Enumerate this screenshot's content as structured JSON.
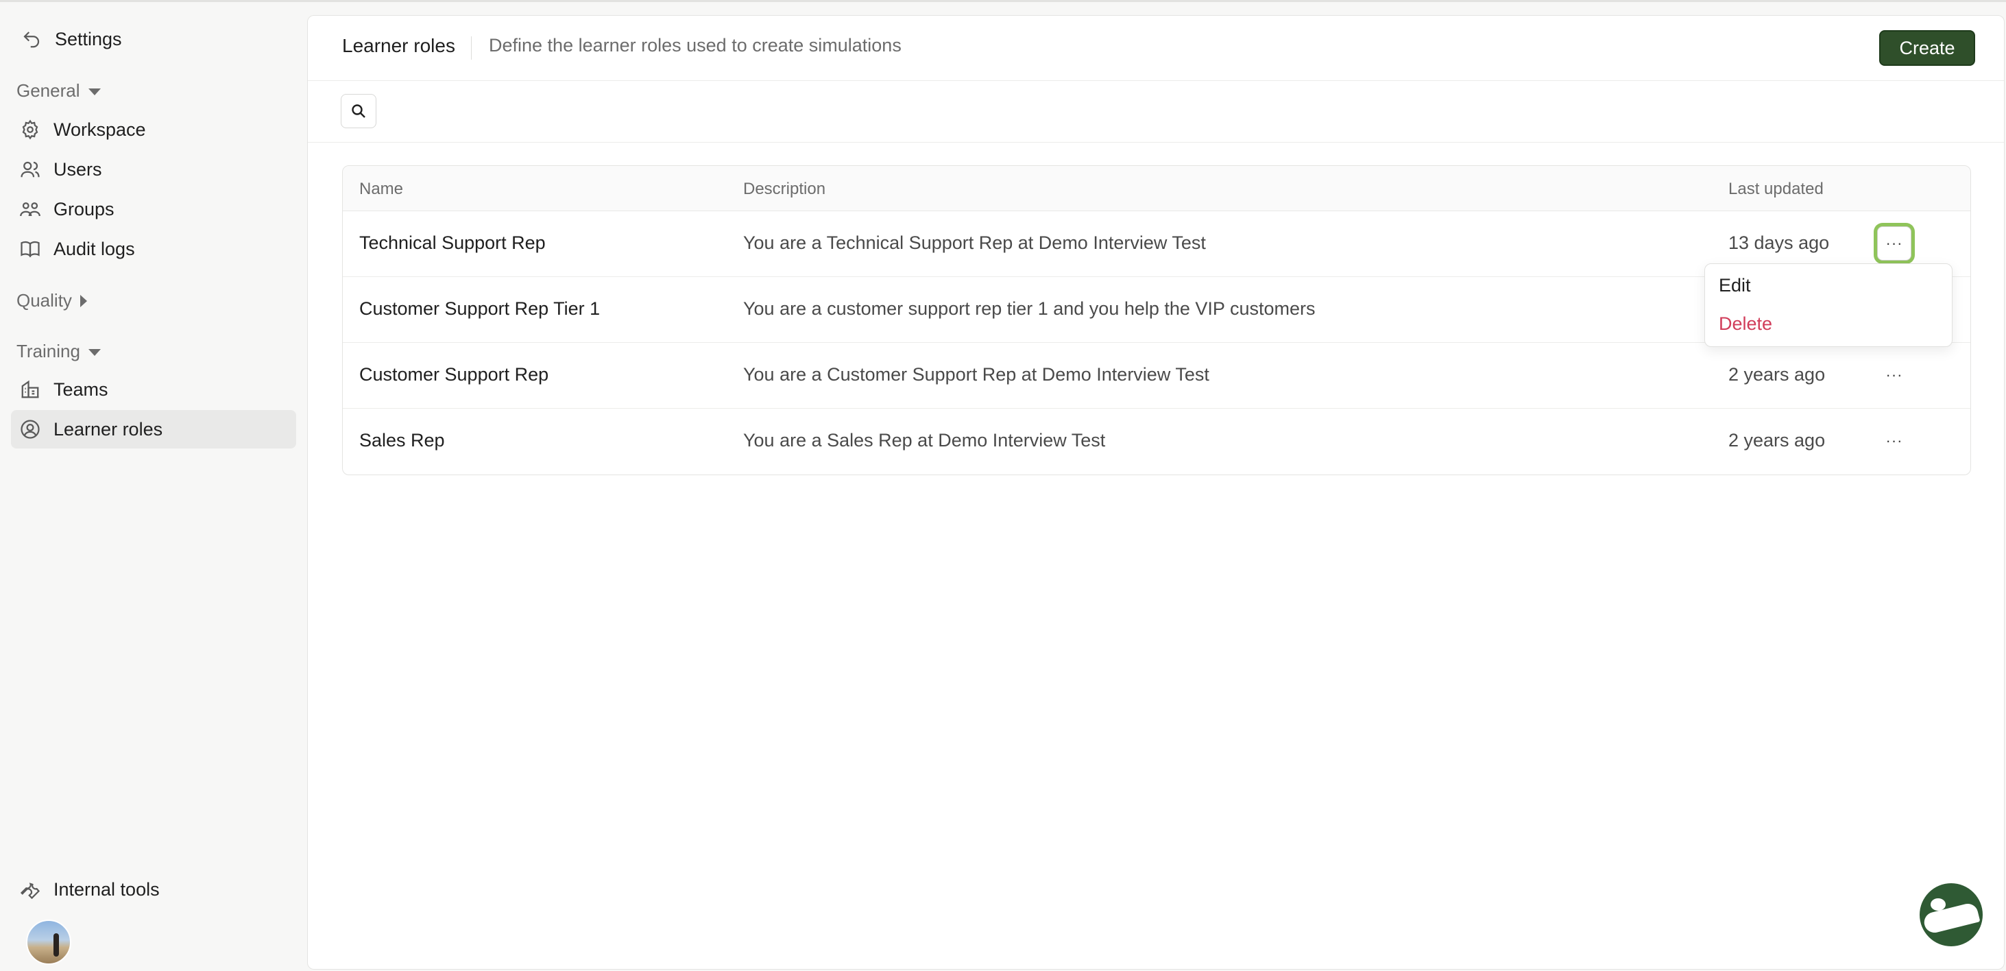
{
  "sidebar": {
    "header": {
      "title": "Settings"
    },
    "sections": {
      "general": "General",
      "quality": "Quality",
      "training": "Training"
    },
    "items": {
      "workspace": "Workspace",
      "users": "Users",
      "groups": "Groups",
      "audit_logs": "Audit logs",
      "teams": "Teams",
      "learner_roles": "Learner roles",
      "internal_tools": "Internal tools"
    }
  },
  "header": {
    "title": "Learner roles",
    "subtitle": "Define the learner roles used to create simulations",
    "create_label": "Create"
  },
  "table": {
    "columns": {
      "name": "Name",
      "description": "Description",
      "last_updated": "Last updated"
    },
    "rows": [
      {
        "name": "Technical Support Rep",
        "description": "You are a Technical Support Rep at Demo Interview Test",
        "last_updated": "13 days ago"
      },
      {
        "name": "Customer Support Rep Tier 1",
        "description": "You are a customer support rep tier 1 and you help the VIP customers",
        "last_updated": ""
      },
      {
        "name": "Customer Support Rep",
        "description": "You are a Customer Support Rep at Demo Interview Test",
        "last_updated": "2 years ago"
      },
      {
        "name": "Sales Rep",
        "description": "You are a Sales Rep at Demo Interview Test",
        "last_updated": "2 years ago"
      }
    ],
    "more_label": "···"
  },
  "row_menu": {
    "edit": "Edit",
    "delete": "Delete"
  },
  "colors": {
    "primary_button": "#2f4f2a",
    "danger": "#d13d5a",
    "focus_ring": "#8fc45a"
  }
}
